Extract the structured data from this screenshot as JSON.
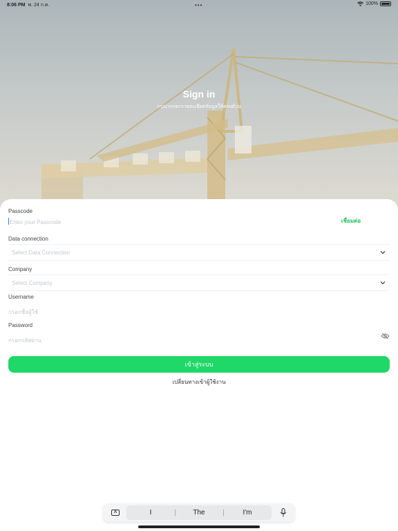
{
  "status": {
    "time": "8:06 PM",
    "date": "พ. 24 ก.ค.",
    "battery": "100%"
  },
  "hero": {
    "title": "Sign in",
    "subtitle": "กรุณากรอกรายละเอียดข้อมูลให้ครบถ้วน"
  },
  "form": {
    "passcode_label": "Passcode",
    "passcode_placeholder": "Enter your Passcode",
    "connect_label": "เชื่อมต่อ",
    "data_connection_label": "Data connection",
    "data_connection_placeholder": "Select Data Connection",
    "company_label": "Company",
    "company_placeholder": "Select Company",
    "username_label": "Username",
    "username_placeholder": "กรอกชื่อผู้ใช้",
    "password_label": "Password",
    "password_placeholder": "กรอกรหัสผ่าน",
    "login_label": "เข้าสู่ระบบ",
    "switch_label": "เปลี่ยนทางเข้าผู้ใช้งาน"
  },
  "keyboard": {
    "suggestions": [
      "I",
      "The",
      "I'm"
    ]
  },
  "colors": {
    "accent": "#20d868",
    "connect_text": "#1ec15a"
  }
}
